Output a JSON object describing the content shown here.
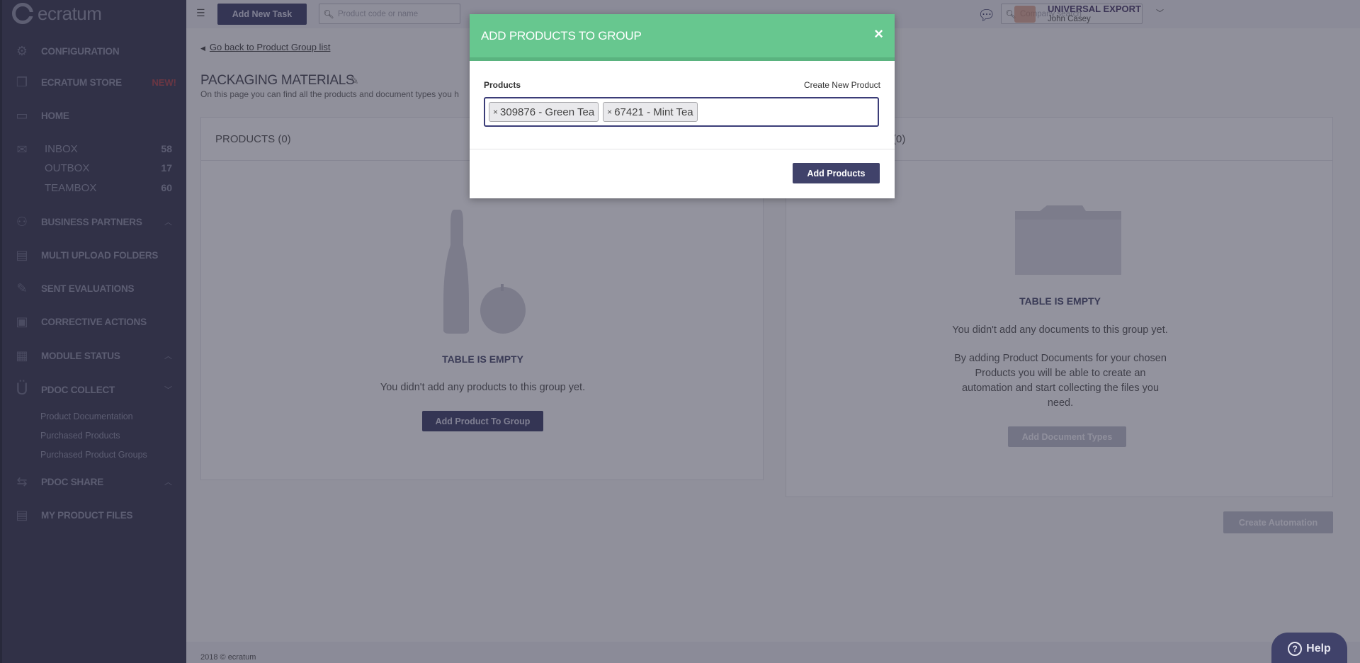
{
  "app": {
    "logo_text": "ecratum"
  },
  "sidebar": {
    "items": [
      {
        "label": "CONFIGURATION",
        "icon": "gears-icon"
      },
      {
        "label": "ECRATUM STORE",
        "badge": "NEW!",
        "icon": "cubes-icon"
      },
      {
        "label": "HOME",
        "icon": "monitor-icon"
      },
      {
        "label": "BUSINESS PARTNERS",
        "icon": "partners-icon"
      },
      {
        "label": "MULTI UPLOAD FOLDERS",
        "icon": "folders-icon"
      },
      {
        "label": "SENT EVALUATIONS",
        "icon": "evaluation-icon"
      },
      {
        "label": "CORRECTIVE ACTIONS",
        "icon": "calendar-icon"
      },
      {
        "label": "MODULE STATUS",
        "icon": "status-icon"
      },
      {
        "label": "PDOC COLLECT",
        "icon": "magnet-icon"
      },
      {
        "label": "PDOC SHARE",
        "icon": "share-icon"
      },
      {
        "label": "MY PRODUCT FILES",
        "icon": "files-icon"
      }
    ],
    "mail": [
      {
        "label": "INBOX",
        "count": "58"
      },
      {
        "label": "OUTBOX",
        "count": "17"
      },
      {
        "label": "TEAMBOX",
        "count": "60"
      }
    ],
    "pdoc_links": [
      "Product Documentation",
      "Purchased Products",
      "Purchased Product Groups"
    ]
  },
  "topbar": {
    "add_task_label": "Add New Task",
    "product_search_placeholder": "Product code or name",
    "company_search_placeholder": "Company search",
    "company_name": "UNIVERSAL EXPORT",
    "user_name": "John Casey"
  },
  "page": {
    "back_link": "Go back to Product Group list",
    "title": "PACKAGING MATERIALS",
    "subtitle": "On this page you can find all the products and document types you h"
  },
  "products_panel": {
    "header": "PRODUCTS (0)",
    "empty_title": "TABLE IS EMPTY",
    "empty_text": "You didn't add any products to this group yet.",
    "button": "Add Product To Group"
  },
  "documents_panel": {
    "header": "(0)",
    "empty_title": "TABLE IS EMPTY",
    "empty_text_1": "You didn't add any documents to this group yet.",
    "empty_text_2": "By adding Product Documents for your chosen Products you will be able to create an automation and start collecting the files you need.",
    "button": "Add Document Types"
  },
  "create_automation_label": "Create Automation",
  "footer": {
    "text": "2018 © ecratum"
  },
  "help": {
    "label": "Help"
  },
  "modal": {
    "title": "ADD PRODUCTS TO GROUP",
    "field_label": "Products",
    "create_link": "Create New Product",
    "tags": [
      "309876 - Green Tea",
      "67421 - Mint Tea"
    ],
    "submit_label": "Add Products"
  },
  "colors": {
    "accent": "#40426a",
    "modal_header": "#67c78f",
    "sidebar": "#3a3b52"
  }
}
